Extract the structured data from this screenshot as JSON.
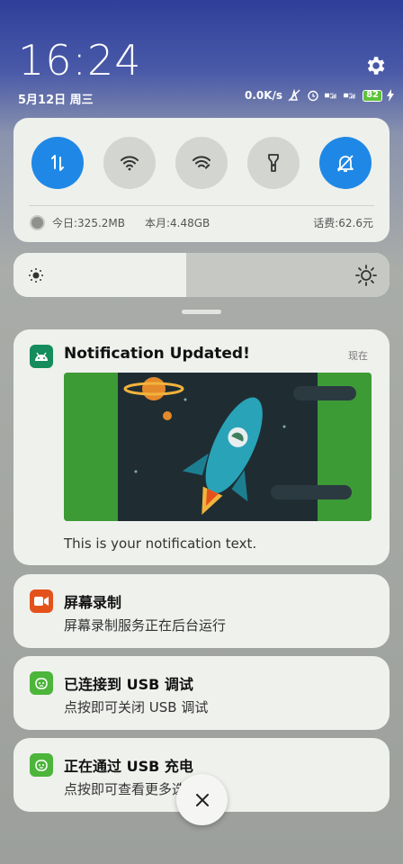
{
  "status_bar": {
    "time": "16:24",
    "date": "5月12日 周三",
    "network_speed": "0.0K/s",
    "network_1": "4G",
    "network_2": "4G",
    "battery": "82"
  },
  "quick_settings": {
    "toggles": [
      {
        "icon": "mobile-data-icon",
        "active": true
      },
      {
        "icon": "wifi-icon",
        "active": false
      },
      {
        "icon": "wifi-hotspot-icon",
        "active": false
      },
      {
        "icon": "flashlight-icon",
        "active": false
      },
      {
        "icon": "silent-bell-icon",
        "active": true
      }
    ],
    "usage_today": "今日:325.2MB",
    "usage_month": "本月:4.48GB",
    "balance": "话费:62.6元"
  },
  "brightness": {
    "level": 0.46
  },
  "notifications": [
    {
      "title": "Notification Updated!",
      "time": "现在",
      "text": "This is your notification text."
    },
    {
      "title": "屏幕录制",
      "text": "屏幕录制服务正在后台运行"
    },
    {
      "title": "已连接到 USB 调试",
      "text": "点按即可关闭 USB 调试"
    },
    {
      "title": "正在通过 USB 充电",
      "text": "点按即可查看更多选项"
    }
  ],
  "colors": {
    "accent": "#1f88e6",
    "panel": "#eef0ec"
  }
}
